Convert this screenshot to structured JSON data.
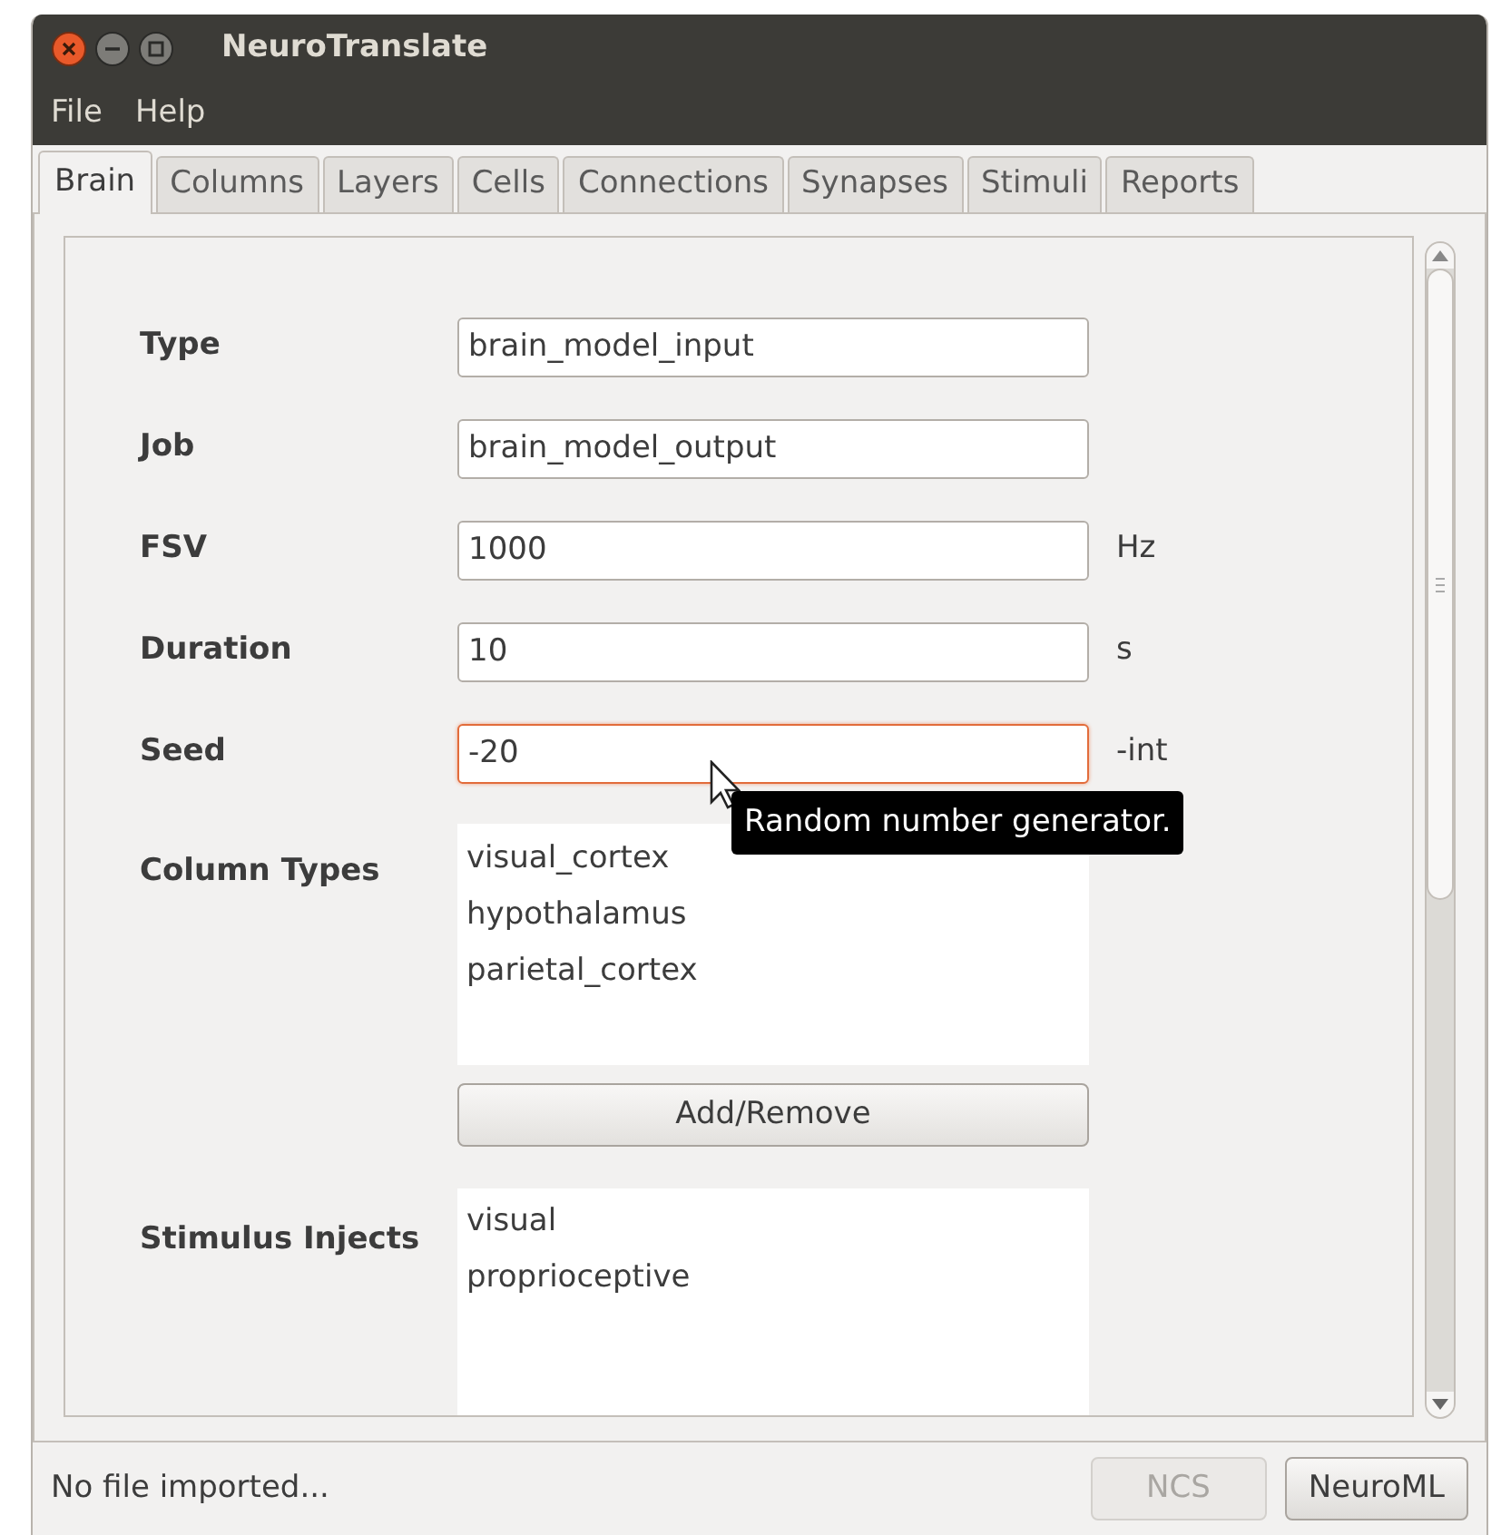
{
  "window": {
    "title": "NeuroTranslate"
  },
  "menu": [
    "File",
    "Help"
  ],
  "tabs": [
    {
      "label": "Brain",
      "selected": true
    },
    {
      "label": "Columns",
      "selected": false
    },
    {
      "label": "Layers",
      "selected": false
    },
    {
      "label": "Cells",
      "selected": false
    },
    {
      "label": "Connections",
      "selected": false
    },
    {
      "label": "Synapses",
      "selected": false
    },
    {
      "label": "Stimuli",
      "selected": false
    },
    {
      "label": "Reports",
      "selected": false
    }
  ],
  "fields": [
    {
      "label": "Type",
      "value": "brain_model_input",
      "focused": false
    },
    {
      "label": "Job",
      "value": "brain_model_output",
      "focused": false
    },
    {
      "label": "FSV",
      "value": "1000",
      "unit": "Hz",
      "focused": false
    },
    {
      "label": "Duration",
      "value": "10",
      "unit": "s",
      "focused": false
    },
    {
      "label": "Seed",
      "value": "-20",
      "unit": "-int",
      "focused": true
    }
  ],
  "column_types": {
    "label": "Column Types",
    "items": [
      "visual_cortex",
      "hypothalamus",
      "parietal_cortex"
    ]
  },
  "add_remove_button": "Add/Remove",
  "stimulus_injects": {
    "label": "Stimulus Injects",
    "items": [
      "visual",
      "proprioceptive"
    ]
  },
  "tooltip": "Random number generator.",
  "status_bar": {
    "text": "No file imported...",
    "buttons": [
      {
        "label": "NCS",
        "disabled": true
      },
      {
        "label": "NeuroML",
        "disabled": false
      }
    ]
  }
}
